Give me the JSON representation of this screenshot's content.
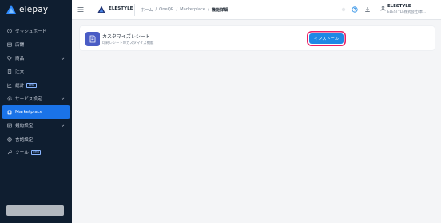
{
  "sidebar": {
    "logo_text": "elepay",
    "items": [
      {
        "label": "ダッシュボード",
        "icon": "clock-icon"
      },
      {
        "label": "店舗",
        "icon": "store-icon"
      },
      {
        "label": "商品",
        "icon": "tag-icon",
        "chevron": true
      },
      {
        "label": "注文",
        "icon": "receipt-icon"
      },
      {
        "label": "統計",
        "icon": "chart-icon",
        "badge": "beta"
      },
      {
        "label": "サービス設定",
        "icon": "gear-icon",
        "chevron": true
      },
      {
        "label": "Marketplace",
        "icon": "marketplace-icon",
        "active": true
      },
      {
        "label": "規約設定",
        "icon": "document-icon",
        "chevron": true
      },
      {
        "label": "言語設定",
        "icon": "globe-icon"
      },
      {
        "label": "ツール",
        "icon": "wrench-icon",
        "badge": "beta"
      }
    ]
  },
  "topbar": {
    "brand": "ELESTYLE",
    "breadcrumb": [
      "ホーム",
      "/",
      "OneQR",
      "/",
      "Marketplace",
      "/",
      "機能詳細"
    ],
    "user_name": "ELESTYLE",
    "user_company": "ELESTYLE株式会社(本..."
  },
  "app": {
    "title": "カスタマイズレシート",
    "description": "印刷レシートのカスタマイズ機能",
    "install_label": "インストール"
  },
  "colors": {
    "sidebar_bg": "#0f1e30",
    "accent": "#1a73e8",
    "install_outline": "#e91e63",
    "app_icon_bg": "#4a5cc5"
  }
}
